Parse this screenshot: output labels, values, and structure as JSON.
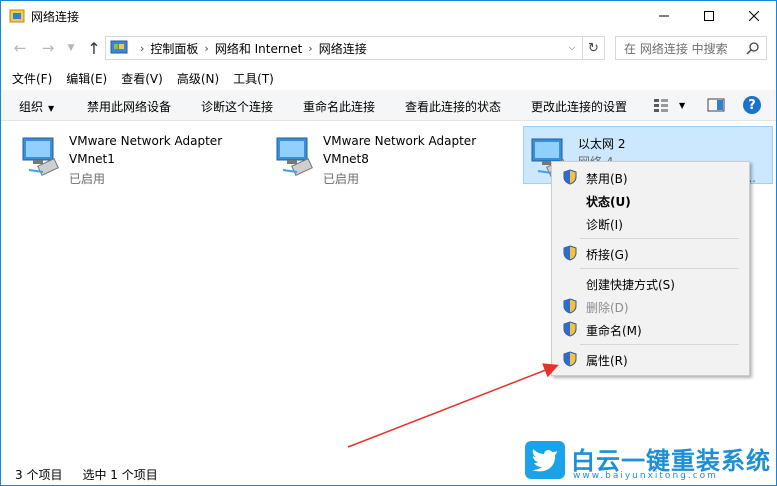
{
  "window": {
    "title": "网络连接"
  },
  "address": {
    "crumbs": [
      "控制面板",
      "网络和 Internet",
      "网络连接"
    ],
    "search_placeholder": "在 网络连接 中搜索"
  },
  "menu": [
    "文件(F)",
    "编辑(E)",
    "查看(V)",
    "高级(N)",
    "工具(T)"
  ],
  "toolbar": {
    "organize": "组织",
    "disable": "禁用此网络设备",
    "diagnose": "诊断这个连接",
    "rename": "重命名此连接",
    "status": "查看此连接的状态",
    "settings": "更改此连接的设置",
    "help": "?"
  },
  "connections": [
    {
      "name": "VMware Network Adapter",
      "sub": "VMnet1",
      "status": "已启用"
    },
    {
      "name": "VMware Network Adapter",
      "sub": "VMnet8",
      "status": "已启用"
    },
    {
      "name": "以太网 2",
      "sub": "网络 4",
      "status": "tr..."
    }
  ],
  "context_menu": {
    "items": [
      "禁用(B)",
      "状态(U)",
      "诊断(I)",
      "桥接(G)",
      "创建快捷方式(S)",
      "删除(D)",
      "重命名(M)",
      "属性(R)"
    ]
  },
  "statusbar": {
    "count": "3 个项目",
    "selected": "选中 1 个项目"
  },
  "watermark": {
    "title": "白云一键重装系统",
    "url": "www.baiyunxitong.com"
  },
  "colors": {
    "accent": "#1883d7",
    "selection": "#cce8ff",
    "arrow": "#e8312a"
  }
}
